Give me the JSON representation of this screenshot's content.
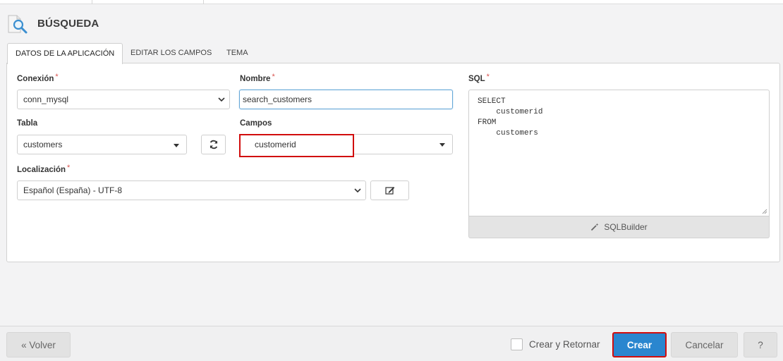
{
  "header": {
    "title": "BÚSQUEDA",
    "icon": "search-file-icon"
  },
  "tabs": [
    {
      "label": "DATOS DE LA APLICACIÓN",
      "active": true
    },
    {
      "label": "EDITAR LOS CAMPOS",
      "active": false
    },
    {
      "label": "TEMA",
      "active": false
    }
  ],
  "form": {
    "connection": {
      "label": "Conexión",
      "required": "*",
      "value": "conn_mysql"
    },
    "name": {
      "label": "Nombre",
      "required": "*",
      "value": "search_customers"
    },
    "table": {
      "label": "Tabla",
      "value": "customers"
    },
    "fields": {
      "label": "Campos",
      "value": "customerid"
    },
    "locale": {
      "label": "Localización",
      "required": "*",
      "value": "Español (España) - UTF-8"
    },
    "sql": {
      "label": "SQL",
      "required": "*",
      "value": "SELECT\n    customerid\nFROM\n    customers",
      "builder_label": "SQLBuilder"
    }
  },
  "footer": {
    "back_label": "« Volver",
    "create_and_return_label": "Crear y Retornar",
    "create_label": "Crear",
    "cancel_label": "Cancelar",
    "help_label": "?"
  },
  "colors": {
    "primary": "#2a86cf",
    "highlight": "#d10d0d",
    "required": "#d9534f"
  }
}
